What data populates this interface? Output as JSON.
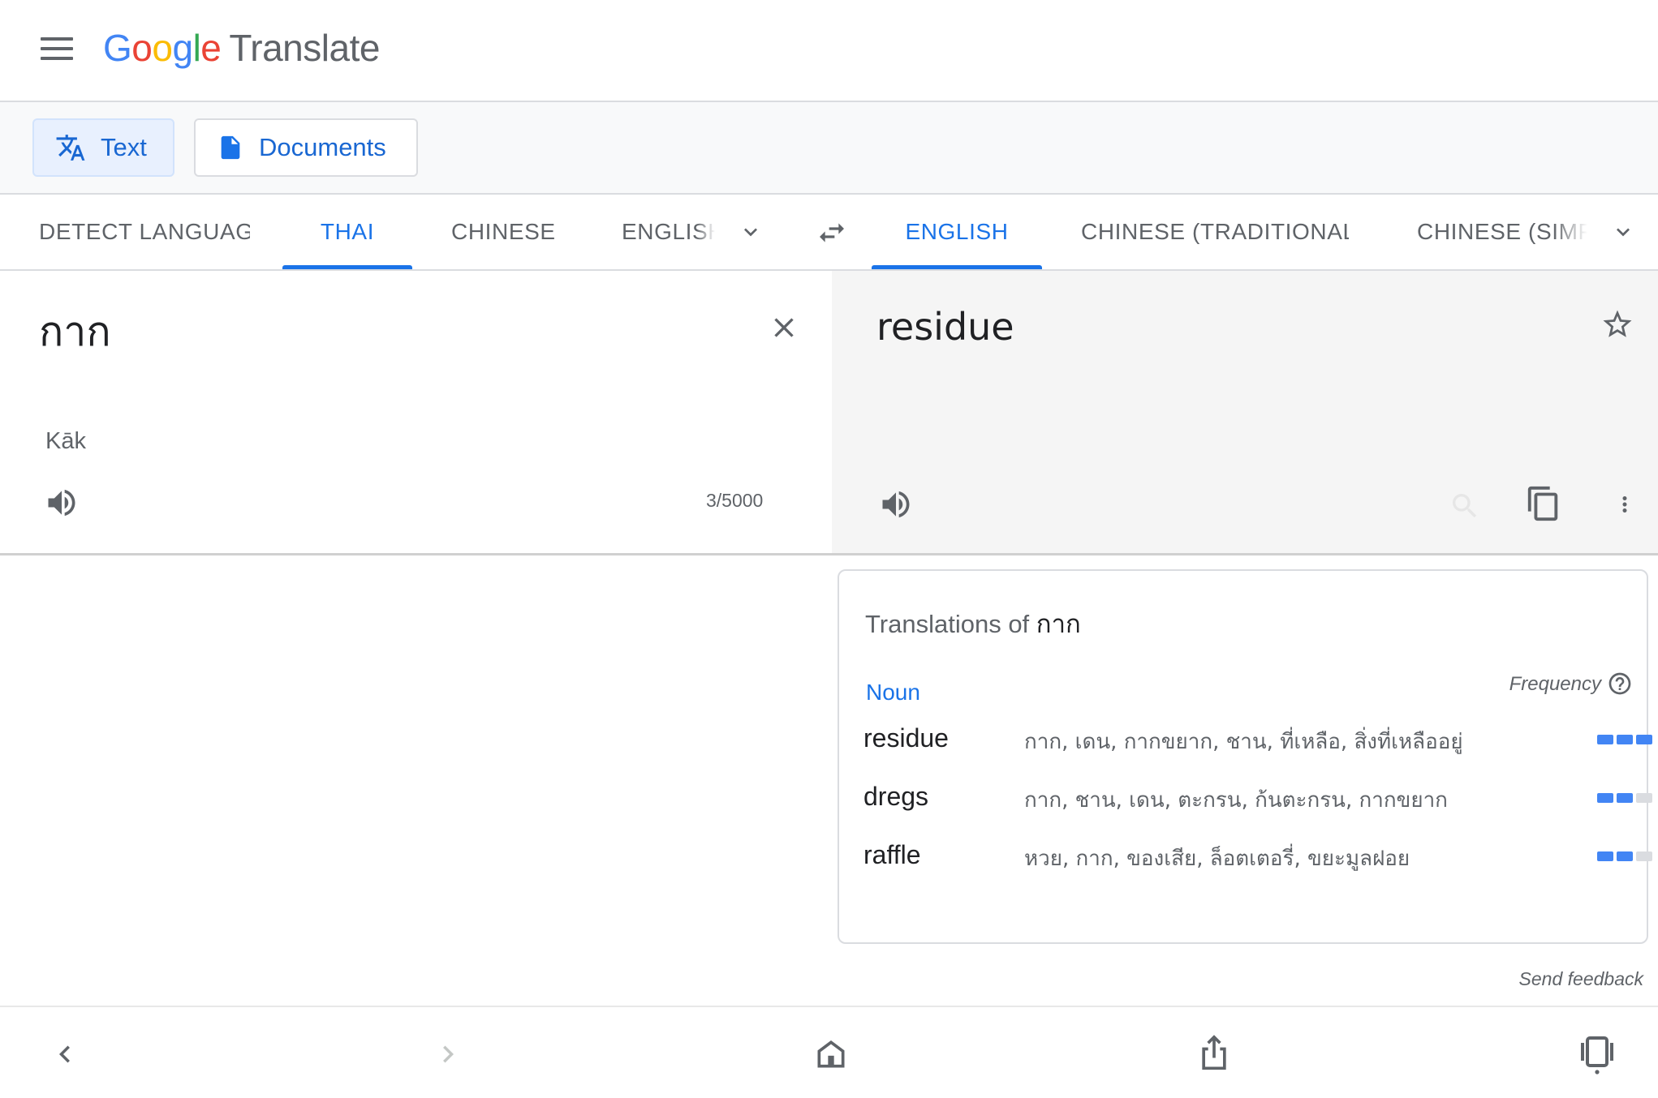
{
  "header": {
    "logo_letters": [
      "G",
      "o",
      "o",
      "g",
      "l",
      "e"
    ],
    "product": "Translate"
  },
  "modes": {
    "text_label": "Text",
    "documents_label": "Documents"
  },
  "source_languages": [
    "DETECT LANGUAGE",
    "THAI",
    "CHINESE",
    "ENGLISH"
  ],
  "target_languages": [
    "ENGLISH",
    "CHINESE (TRADITIONAL)",
    "CHINESE (SIMPLIFIED)"
  ],
  "source": {
    "text": "กาก",
    "transliteration": "Kāk",
    "char_count": "3/5000"
  },
  "target": {
    "text": "residue"
  },
  "dictionary": {
    "title_prefix": "Translations of",
    "term": "กาก",
    "part_of_speech": "Noun",
    "frequency_label": "Frequency",
    "entries": [
      {
        "word": "residue",
        "synonyms": "กาก, เดน, กากขยาก, ชาน, ที่เหลือ, สิ่งที่เหลืออยู่",
        "frequency": 3
      },
      {
        "word": "dregs",
        "synonyms": "กาก, ชาน, เดน, ตะกรน, ก้นตะกรน, กากขยาก",
        "frequency": 2
      },
      {
        "word": "raffle",
        "synonyms": "หวย, กาก, ของเสีย, ล็อตเตอรี่, ขยะมูลฝอย",
        "frequency": 2
      }
    ]
  },
  "feedback_label": "Send feedback",
  "colors": {
    "accent": "#1a73e8",
    "freq_on": "#4285f4",
    "freq_off": "#dadce0",
    "target_bg": "#f5f5f5"
  }
}
